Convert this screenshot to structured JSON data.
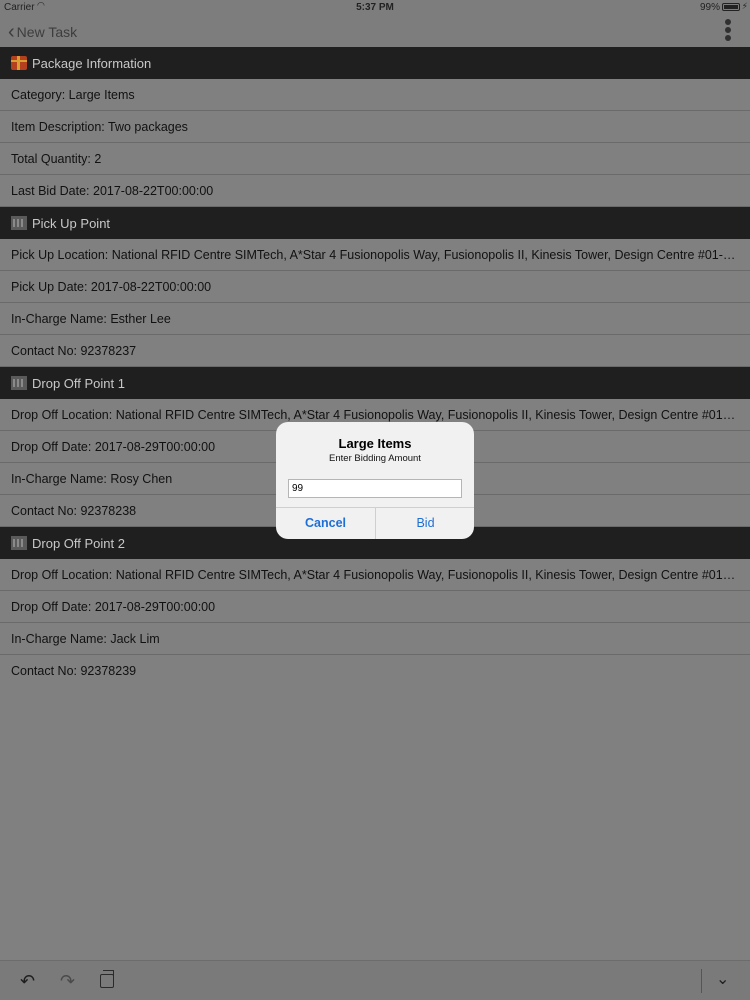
{
  "status_bar": {
    "carrier": "Carrier",
    "time": "5:37 PM",
    "battery": "99%"
  },
  "nav": {
    "back_label": "New Task"
  },
  "sections": [
    {
      "title": "Package Information",
      "icon": "gift-icon",
      "rows": [
        "Category: Large Items",
        "Item Description: Two packages",
        "Total Quantity: 2",
        "Last Bid Date: 2017-08-22T00:00:00"
      ]
    },
    {
      "title": "Pick Up Point",
      "icon": "building-icon",
      "rows": [
        "Pick Up Location: National RFID Centre SIMTech, A*Star 4 Fusionopolis Way, Fusionopolis II, Kinesis Tower, Design Centre #01-0...",
        "Pick Up Date: 2017-08-22T00:00:00",
        "In-Charge Name: Esther Lee",
        "Contact No: 92378237"
      ]
    },
    {
      "title": "Drop Off Point 1",
      "icon": "building-icon",
      "rows": [
        "Drop Off Location: National RFID Centre SIMTech, A*Star 4 Fusionopolis Way, Fusionopolis II, Kinesis Tower, Design Centre #01-...",
        "Drop Off Date: 2017-08-29T00:00:00",
        "In-Charge Name: Rosy Chen",
        "Contact No: 92378238"
      ]
    },
    {
      "title": "Drop Off Point 2",
      "icon": "building-icon",
      "rows": [
        "Drop Off Location: National RFID Centre SIMTech, A*Star 4 Fusionopolis Way, Fusionopolis II, Kinesis Tower, Design Centre #01-...",
        "Drop Off Date: 2017-08-29T00:00:00",
        "In-Charge Name: Jack Lim",
        "Contact No: 92378239"
      ]
    }
  ],
  "dialog": {
    "title": "Large Items",
    "message": "Enter Bidding Amount",
    "input_value": "99",
    "cancel_label": "Cancel",
    "bid_label": "Bid"
  },
  "colors": {
    "accent": "#1d6fd6",
    "section_header_bg": "#1f1f1f"
  }
}
